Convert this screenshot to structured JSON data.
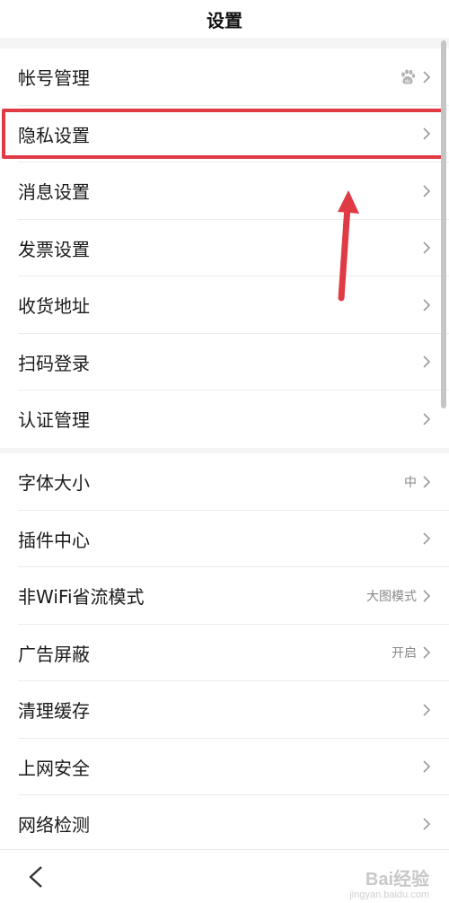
{
  "header": {
    "title": "设置"
  },
  "group1": [
    {
      "label": "帐号管理",
      "value": "",
      "icon": "baidu-paw-icon"
    },
    {
      "label": "隐私设置",
      "value": ""
    },
    {
      "label": "消息设置",
      "value": ""
    },
    {
      "label": "发票设置",
      "value": ""
    },
    {
      "label": "收货地址",
      "value": ""
    },
    {
      "label": "扫码登录",
      "value": ""
    },
    {
      "label": "认证管理",
      "value": ""
    }
  ],
  "group2": [
    {
      "label": "字体大小",
      "value": "中"
    },
    {
      "label": "插件中心",
      "value": ""
    },
    {
      "label": "非WiFi省流模式",
      "value": "大图模式"
    },
    {
      "label": "广告屏蔽",
      "value": "开启"
    },
    {
      "label": "清理缓存",
      "value": ""
    },
    {
      "label": "上网安全",
      "value": ""
    },
    {
      "label": "网络检测",
      "value": ""
    }
  ],
  "watermark": {
    "text": "Bai经验",
    "sub": "jingyan.baidu.com"
  },
  "colors": {
    "highlight": "#e03a45",
    "background": "#f5f5f5",
    "text": "#1a1a1a",
    "secondary": "#888888"
  }
}
